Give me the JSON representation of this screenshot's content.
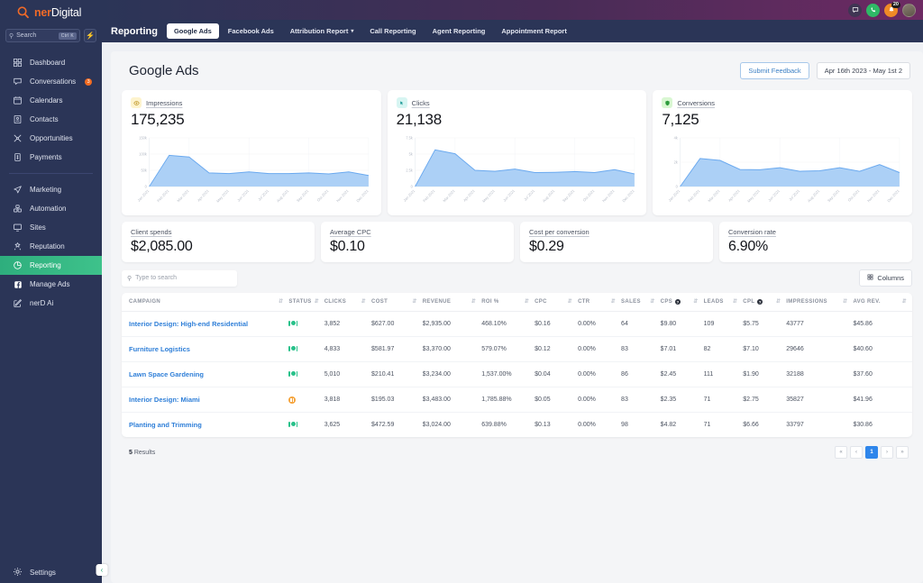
{
  "brand": {
    "name_prefix": "ner",
    "name_suffix": "Digital",
    "logo_icon": "magnifier-head-logo"
  },
  "sidebar": {
    "search": {
      "placeholder": "Search",
      "shortcut": "Ctrl K",
      "icon": "search-icon",
      "bolt_icon": "lightning-bolt-icon"
    },
    "items": [
      {
        "label": "Dashboard",
        "icon": "grid-icon",
        "active": false,
        "badge": ""
      },
      {
        "label": "Conversations",
        "icon": "chat-icon",
        "active": false,
        "badge": "3"
      },
      {
        "label": "Calendars",
        "icon": "calendar-icon",
        "active": false,
        "badge": ""
      },
      {
        "label": "Contacts",
        "icon": "contact-card-icon",
        "active": false,
        "badge": ""
      },
      {
        "label": "Opportunities",
        "icon": "funnel-icon",
        "active": false,
        "badge": ""
      },
      {
        "label": "Payments",
        "icon": "payments-icon",
        "active": false,
        "badge": ""
      },
      {
        "label": "Marketing",
        "icon": "paper-plane-icon",
        "active": false,
        "badge": ""
      },
      {
        "label": "Automation",
        "icon": "automation-icon",
        "active": false,
        "badge": ""
      },
      {
        "label": "Sites",
        "icon": "monitor-icon",
        "active": false,
        "badge": ""
      },
      {
        "label": "Reputation",
        "icon": "star-burst-icon",
        "active": false,
        "badge": ""
      },
      {
        "label": "Reporting",
        "icon": "pie-chart-icon",
        "active": true,
        "badge": ""
      },
      {
        "label": "Manage Ads",
        "icon": "facebook-icon",
        "active": false,
        "badge": ""
      },
      {
        "label": "nerD Ai",
        "icon": "pencil-square-icon",
        "active": false,
        "badge": ""
      }
    ],
    "settings": {
      "label": "Settings",
      "icon": "gear-icon"
    },
    "collapse": {
      "icon": "chevron-left-icon"
    }
  },
  "topbar": {
    "icons": [
      {
        "name": "chat-bubble-icon",
        "glyph": "▭",
        "badge": ""
      },
      {
        "name": "phone-icon",
        "glyph": "✆",
        "badge": ""
      },
      {
        "name": "notification-bell-icon",
        "glyph": "◔",
        "badge": "20"
      }
    ],
    "avatar": "user-avatar"
  },
  "navbar": {
    "title": "Reporting",
    "tabs": [
      {
        "label": "Google Ads",
        "active": true,
        "caret": false
      },
      {
        "label": "Facebook Ads",
        "active": false,
        "caret": false
      },
      {
        "label": "Attribution Report",
        "active": false,
        "caret": true
      },
      {
        "label": "Call Reporting",
        "active": false,
        "caret": false
      },
      {
        "label": "Agent Reporting",
        "active": false,
        "caret": false
      },
      {
        "label": "Appointment Report",
        "active": false,
        "caret": false
      }
    ]
  },
  "page": {
    "title": "Google Ads",
    "feedback_label": "Submit Feedback",
    "date_range": "Apr 16th 2023 - May 1st 2"
  },
  "chart_data": [
    {
      "type": "area",
      "title": "Impressions",
      "icon": "eye-icon",
      "total": "175,235",
      "categories": [
        "Jan 2021",
        "Feb 2021",
        "Mar 2021",
        "Apr 2021",
        "May 2021",
        "Jun 2021",
        "Jul 2021",
        "Aug 2021",
        "Sep 2021",
        "Oct 2021",
        "Nov 2021",
        "Dec 2021"
      ],
      "values": [
        0,
        96000,
        91000,
        42000,
        40000,
        45000,
        40000,
        40000,
        42000,
        39000,
        45000,
        34000
      ],
      "yticks": [
        "0",
        "50k",
        "100k",
        "150k"
      ],
      "ylim": [
        0,
        150000
      ],
      "xlabel": "",
      "ylabel": "",
      "grid": true,
      "legend": "none"
    },
    {
      "type": "area",
      "title": "Clicks",
      "icon": "cursor-click-icon",
      "total": "21,138",
      "categories": [
        "Jan 2021",
        "Feb 2021",
        "Mar 2021",
        "Apr 2021",
        "May 2021",
        "Jun 2021",
        "Jul 2021",
        "Aug 2021",
        "Sep 2021",
        "Oct 2021",
        "Nov 2021",
        "Dec 2021"
      ],
      "values": [
        0,
        5650,
        5050,
        2500,
        2350,
        2700,
        2150,
        2200,
        2300,
        2150,
        2600,
        1950
      ],
      "yticks": [
        "0",
        "2.5k",
        "5k",
        "7.5k"
      ],
      "ylim": [
        0,
        7500
      ],
      "xlabel": "",
      "ylabel": "",
      "grid": true,
      "legend": "none"
    },
    {
      "type": "area",
      "title": "Conversions",
      "icon": "shield-check-icon",
      "total": "7,125",
      "categories": [
        "Jan 2021",
        "Feb 2021",
        "Mar 2021",
        "Apr 2021",
        "May 2021",
        "Jun 2021",
        "Jul 2021",
        "Aug 2021",
        "Sep 2021",
        "Oct 2021",
        "Nov 2021",
        "Dec 2021"
      ],
      "values": [
        0,
        2300,
        2150,
        1400,
        1380,
        1550,
        1250,
        1300,
        1550,
        1250,
        1800,
        1150
      ],
      "yticks": [
        "0",
        "2k",
        "4k"
      ],
      "ylim": [
        0,
        4000
      ],
      "xlabel": "",
      "ylabel": "",
      "grid": true,
      "legend": "none"
    }
  ],
  "stats": [
    {
      "label": "Client spends",
      "value": "$2,085.00"
    },
    {
      "label": "Average CPC",
      "value": "$0.10"
    },
    {
      "label": "Cost per conversion",
      "value": "$0.29"
    },
    {
      "label": "Conversion rate",
      "value": "6.90%"
    }
  ],
  "table": {
    "search_placeholder": "Type to search",
    "search_value": "",
    "columns_label": "Columns",
    "columns_icon": "columns-icon",
    "headers": [
      {
        "label": "CAMPAIGN",
        "info": false
      },
      {
        "label": "STATUS",
        "info": false
      },
      {
        "label": "CLICKS",
        "info": false
      },
      {
        "label": "COST",
        "info": false
      },
      {
        "label": "REVENUE",
        "info": false
      },
      {
        "label": "ROI %",
        "info": false
      },
      {
        "label": "CPC",
        "info": false
      },
      {
        "label": "CTR",
        "info": false
      },
      {
        "label": "SALES",
        "info": false
      },
      {
        "label": "CPS",
        "info": true
      },
      {
        "label": "LEADS",
        "info": false
      },
      {
        "label": "CPL",
        "info": true
      },
      {
        "label": "IMPRESSIONS",
        "info": false
      },
      {
        "label": "AVG REV.",
        "info": false
      }
    ],
    "rows": [
      {
        "campaign": "Interior Design: High-end Residential",
        "status": "active",
        "clicks": "3,852",
        "cost": "$627.00",
        "revenue": "$2,935.00",
        "roi": "468.10%",
        "cpc": "$0.16",
        "ctr": "0.00%",
        "sales": "64",
        "cps": "$9.80",
        "leads": "109",
        "cpl": "$5.75",
        "impressions": "43777",
        "avg_rev": "$45.86"
      },
      {
        "campaign": "Furniture Logistics",
        "status": "active",
        "clicks": "4,833",
        "cost": "$581.97",
        "revenue": "$3,370.00",
        "roi": "579.07%",
        "cpc": "$0.12",
        "ctr": "0.00%",
        "sales": "83",
        "cps": "$7.01",
        "leads": "82",
        "cpl": "$7.10",
        "impressions": "29646",
        "avg_rev": "$40.60"
      },
      {
        "campaign": "Lawn Space Gardening",
        "status": "active",
        "clicks": "5,010",
        "cost": "$210.41",
        "revenue": "$3,234.00",
        "roi": "1,537.00%",
        "cpc": "$0.04",
        "ctr": "0.00%",
        "sales": "86",
        "cps": "$2.45",
        "leads": "111",
        "cpl": "$1.90",
        "impressions": "32188",
        "avg_rev": "$37.60"
      },
      {
        "campaign": "Interior Design: Miami",
        "status": "paused",
        "clicks": "3,818",
        "cost": "$195.03",
        "revenue": "$3,483.00",
        "roi": "1,785.88%",
        "cpc": "$0.05",
        "ctr": "0.00%",
        "sales": "83",
        "cps": "$2.35",
        "leads": "71",
        "cpl": "$2.75",
        "impressions": "35827",
        "avg_rev": "$41.96"
      },
      {
        "campaign": "Planting and Trimming",
        "status": "active",
        "clicks": "3,625",
        "cost": "$472.59",
        "revenue": "$3,024.00",
        "roi": "639.88%",
        "cpc": "$0.13",
        "ctr": "0.00%",
        "sales": "98",
        "cps": "$4.82",
        "leads": "71",
        "cpl": "$6.66",
        "impressions": "33797",
        "avg_rev": "$30.86"
      }
    ],
    "results_count": "5",
    "results_label": "Results",
    "pagination": {
      "first": "«",
      "prev": "‹",
      "pages": [
        "1"
      ],
      "next": "›",
      "last": "»",
      "current": "1"
    }
  },
  "colors": {
    "sidebar_bg": "#2b3557",
    "accent_green": "#2eae7d",
    "chart_fill": "#a8cdf5",
    "chart_line": "#6aa9ef",
    "link_blue": "#2f7fd8",
    "pager_active": "#2f86eb",
    "badge_orange": "#f26b21"
  }
}
